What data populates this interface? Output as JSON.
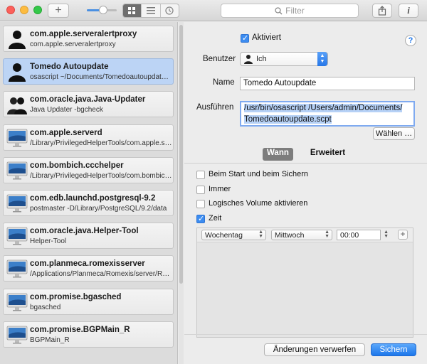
{
  "toolbar": {
    "add_label": "+",
    "zoom_percent": 55,
    "view_icons": [
      "grid-view-icon",
      "list-view-icon",
      "history-icon"
    ],
    "filter_placeholder": "Filter",
    "share_icon": "share-icon",
    "info_label": "i"
  },
  "sidebar": {
    "items": [
      {
        "title": "com.apple.serveralertproxy",
        "subtitle": "com.apple.serveralertproxy",
        "icon": "user-icon"
      },
      {
        "title": "Tomedo Autoupdate",
        "subtitle": "osascript ~/Documents/Tomedoautoupdate.scpt",
        "icon": "user-icon",
        "selected": true
      },
      {
        "title": "com.oracle.java.Java-Updater",
        "subtitle": "Java Updater -bgcheck",
        "icon": "users-icon"
      },
      {
        "title": "com.apple.serverd",
        "subtitle": "/Library/PrivilegedHelperTools/com.apple.serverd",
        "icon": "imac-icon"
      },
      {
        "title": "com.bombich.ccchelper",
        "subtitle": "/Library/PrivilegedHelperTools/com.bombich.ccchelper",
        "icon": "imac-icon"
      },
      {
        "title": "com.edb.launchd.postgresql-9.2",
        "subtitle": "postmaster -D/Library/PostgreSQL/9.2/data",
        "icon": "imac-icon"
      },
      {
        "title": "com.oracle.java.Helper-Tool",
        "subtitle": "Helper-Tool",
        "icon": "imac-icon"
      },
      {
        "title": "com.planmeca.romexisserver",
        "subtitle": "/Applications/Planmeca/Romexis/server/Romexis",
        "icon": "imac-icon"
      },
      {
        "title": "com.promise.bgasched",
        "subtitle": "bgasched",
        "icon": "imac-icon"
      },
      {
        "title": "com.promise.BGPMain_R",
        "subtitle": "BGPMain_R",
        "icon": "imac-icon"
      }
    ]
  },
  "detail": {
    "enabled_label": "Aktiviert",
    "help_label": "?",
    "user_label": "Benutzer",
    "user_value": "Ich",
    "name_label": "Name",
    "name_value": "Tomedo Autoupdate",
    "run_label": "Ausführen",
    "run_value_line1": "/usr/bin/osascript /Users/admin/Documents/",
    "run_value_line2": "Tomedoautoupdate.scpt",
    "choose_button": "Wählen …",
    "tabs": [
      "Wann",
      "Erweitert"
    ],
    "options": [
      {
        "label": "Beim Start und beim Sichern",
        "checked": false
      },
      {
        "label": "Immer",
        "checked": false
      },
      {
        "label": "Logisches Volume aktivieren",
        "checked": false
      },
      {
        "label": "Zeit",
        "checked": true
      }
    ],
    "schedule": {
      "unit": "Wochentag",
      "day": "Mittwoch",
      "time": "00:00"
    },
    "discard_button": "Änderungen verwerfen",
    "save_button": "Sichern"
  },
  "colors": {
    "accent": "#2677e8",
    "selection": "#bcd4f5"
  }
}
